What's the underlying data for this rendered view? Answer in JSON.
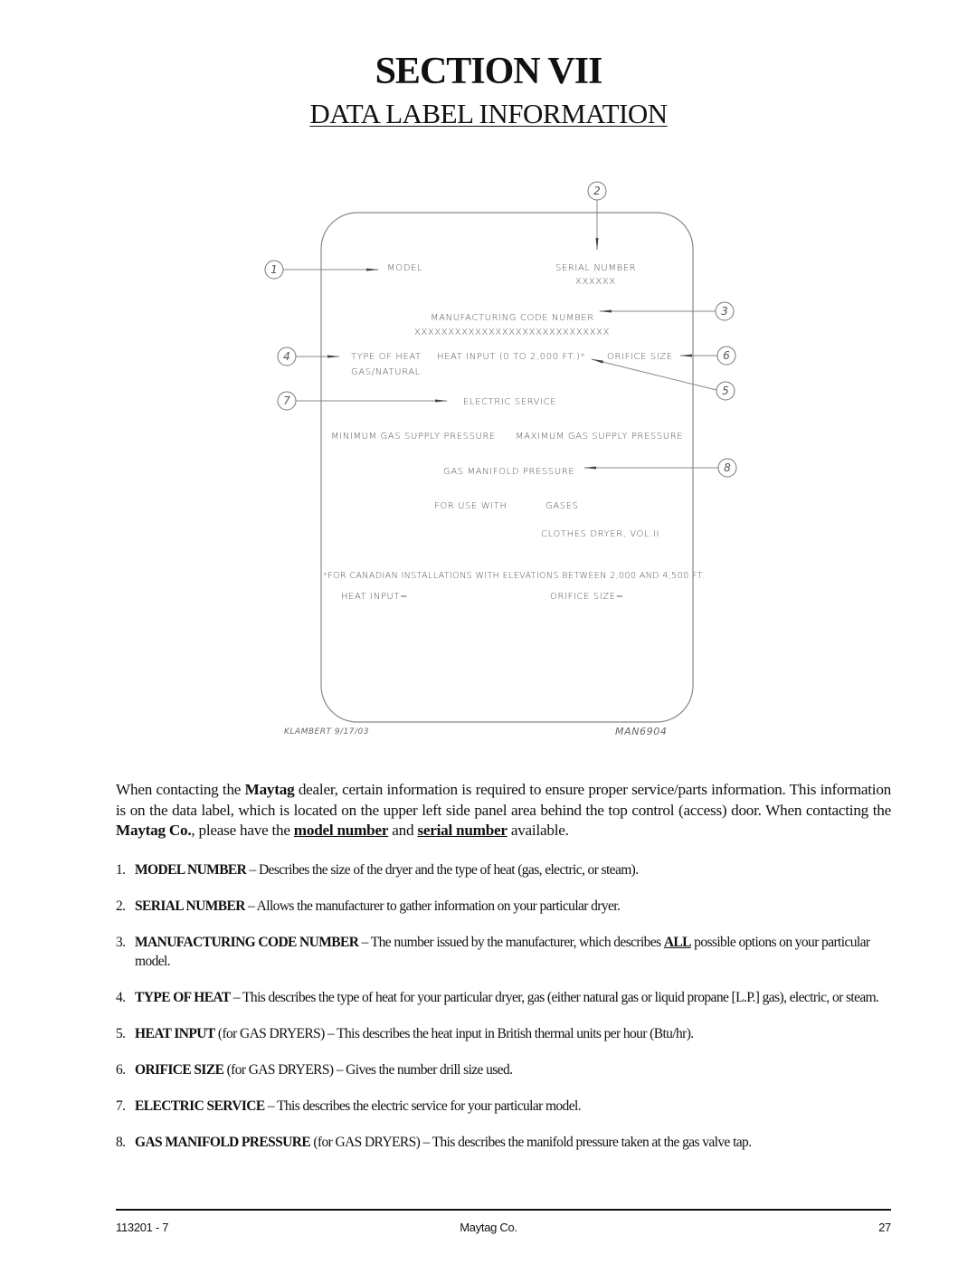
{
  "header": {
    "section_title": "SECTION VII",
    "subtitle": "DATA LABEL INFORMATION"
  },
  "diagram": {
    "label_fields": {
      "model": "MODEL",
      "serial_number": "SERIAL NUMBER",
      "serial_value": "XXXXXX",
      "mfg_code": "MANUFACTURING CODE NUMBER",
      "mfg_code_value": "XXXXXXXXXXXXXXXXXXXXXXXXXXXXX",
      "type_of_heat": "TYPE OF HEAT",
      "heat_input": "HEAT INPUT (0 TO 2,000 FT.)*",
      "orifice_size": "ORIFICE SIZE",
      "gas_natural": "GAS/NATURAL",
      "electric_service": "ELECTRIC SERVICE",
      "min_gas_pressure": "MINIMUM GAS SUPPLY PRESSURE",
      "max_gas_pressure": "MAXIMUM GAS SUPPLY PRESSURE",
      "gas_manifold_pressure": "GAS MANIFOLD PRESSURE",
      "for_use_with": "FOR USE WITH",
      "gases": "GASES",
      "clothes_dryer": "CLOTHES DRYER, VOL.II",
      "canadian_note": "*FOR CANADIAN INSTALLATIONS WITH ELEVATIONS BETWEEN 2,000 AND 4,500 FT.",
      "heat_input_eq": "HEAT INPUT=",
      "orifice_size_eq": "ORIFICE SIZE="
    },
    "callouts": [
      "1",
      "2",
      "3",
      "4",
      "5",
      "6",
      "7",
      "8"
    ],
    "drawn_by": "KLAMBERT 9/17/03",
    "drawing_number": "MAN6904"
  },
  "intro": {
    "p1": "When contacting the ",
    "brand1": "Maytag",
    "p2": " dealer, certain information is required to ensure proper service/parts information. This information is on the data label, which is located on the upper left side panel area behind the top control (access) door.  When contacting the ",
    "brand2": "Maytag Co.",
    "p3": ", please have the ",
    "model_number": "model number",
    "p4": " and ",
    "serial_number": "serial number",
    "p5": " available."
  },
  "items": [
    {
      "num": "1.",
      "term": "MODEL NUMBER",
      "rest": " – Describes the size of the dryer and the type of heat (gas, electric, or steam)."
    },
    {
      "num": "2.",
      "term": "SERIAL NUMBER",
      "rest": " – Allows the manufacturer to gather information on your particular dryer."
    },
    {
      "num": "3.",
      "term": "MANUFACTURING CODE NUMBER",
      "rest": " – The number issued by the manufacturer, which describes ",
      "emph": "ALL",
      "rest2": " possible options on your particular model."
    },
    {
      "num": "4.",
      "term": "TYPE OF HEAT",
      "rest": " – This describes the type of heat for your particular dryer, gas (either natural gas or liquid propane [L.P.] gas), electric, or steam."
    },
    {
      "num": "5.",
      "term": "HEAT INPUT",
      "rest": " (for GAS DRYERS) – This describes the heat input in British thermal units per hour (Btu/hr)."
    },
    {
      "num": "6.",
      "term": "ORIFICE SIZE",
      "rest": " (for GAS DRYERS) – Gives the number drill size used."
    },
    {
      "num": "7.",
      "term": "ELECTRIC SERVICE",
      "rest": " – This describes the electric service for your particular model."
    },
    {
      "num": "8.",
      "term": "GAS MANIFOLD PRESSURE",
      "rest": " (for GAS DRYERS) – This describes the manifold pressure taken at the gas valve tap."
    }
  ],
  "footer": {
    "doc_number": "113201 - 7",
    "company": "Maytag Co.",
    "page_number": "27"
  }
}
